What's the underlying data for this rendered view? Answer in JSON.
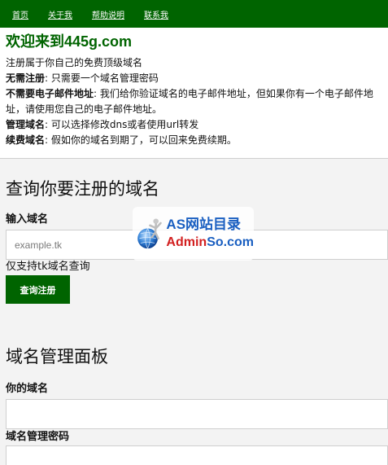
{
  "nav": {
    "items": [
      "首页",
      "关于我",
      "帮助说明",
      "联系我"
    ]
  },
  "intro": {
    "title": "欢迎来到445g.com",
    "line1": "注册属于你自己的免费顶级域名",
    "items": [
      {
        "term": "无需注册",
        "text": ": 只需要一个域名管理密码"
      },
      {
        "term": "不需要电子邮件地址",
        "text": ": 我们给你验证域名的电子邮件地址，但如果你有一个电子邮件地址，请使用您自己的电子邮件地址。"
      },
      {
        "term": "管理域名",
        "text": ": 可以选择修改dns或者使用url转发"
      },
      {
        "term": "续费域名",
        "text": ": 假如你的域名到期了，可以回来免费续期。"
      }
    ]
  },
  "register": {
    "heading": "查询你要注册的域名",
    "input_label": "输入域名",
    "input_placeholder": "example.tk",
    "hint": "仅支持tk域名查询",
    "button": "查询注册"
  },
  "manage": {
    "heading": "域名管理面板",
    "domain_label": "你的域名",
    "password_label": "域名管理密码"
  },
  "watermark": {
    "line1": "AS网站目录",
    "line2_red": "Admin",
    "line2_blue": "So.com"
  },
  "colors": {
    "brand": "#006400",
    "watermark_blue": "#1a5fc1",
    "watermark_red": "#d21f1f"
  }
}
